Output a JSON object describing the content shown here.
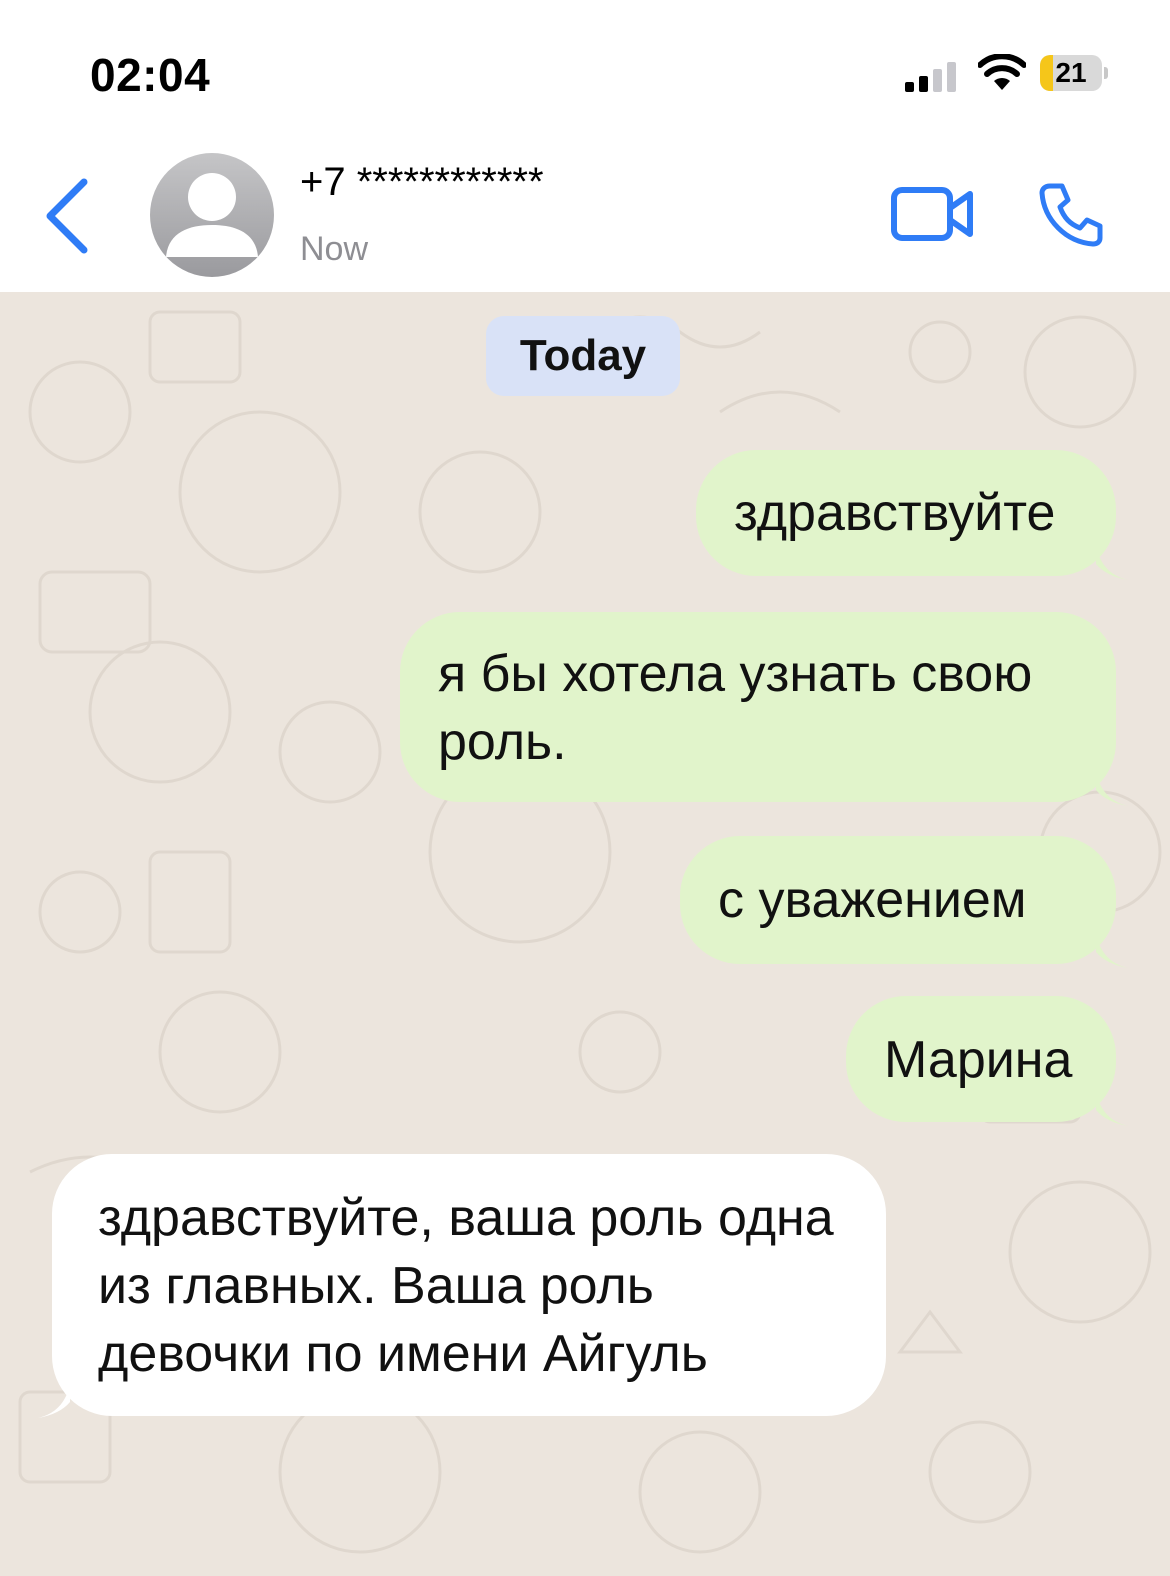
{
  "status_bar": {
    "time": "02:04",
    "battery_level": "21",
    "battery_fraction": 0.21,
    "icons": [
      "signal-icon",
      "wifi-icon",
      "battery-icon"
    ]
  },
  "header": {
    "back_icon": "chevron-left-icon",
    "contact_name": "+7 ************",
    "contact_status": "Now",
    "video_icon": "video-camera-icon",
    "call_icon": "phone-icon",
    "accent_color": "#2f7cf6"
  },
  "chat": {
    "date_divider": "Today",
    "messages": [
      {
        "direction": "outgoing",
        "text": "здравствуйте"
      },
      {
        "direction": "outgoing",
        "text": "я бы хотела узнать свою роль."
      },
      {
        "direction": "outgoing",
        "text": "с уважением"
      },
      {
        "direction": "outgoing",
        "text": "Марина"
      },
      {
        "direction": "incoming",
        "text": "здравствуйте, ваша роль одна из главных. Ваша роль девочки по имени Айгуль"
      }
    ],
    "colors": {
      "outgoing_bubble": "#e1f4cb",
      "incoming_bubble": "#ffffff",
      "background": "#ece5dd",
      "date_chip": "#d9e2f7"
    }
  }
}
